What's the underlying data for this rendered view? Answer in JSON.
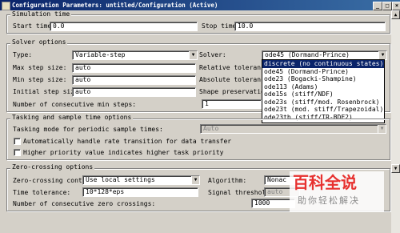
{
  "window": {
    "title": "Configuration Parameters: untitled/Configuration (Active)",
    "minimize": "_",
    "maximize": "□",
    "close": "×"
  },
  "simulation_time": {
    "group_label": "Simulation time",
    "start_label": "Start time:",
    "start_value": "0.0",
    "stop_label": "Stop time:",
    "stop_value": "10.0"
  },
  "solver_options": {
    "group_label": "Solver options",
    "type_label": "Type:",
    "type_value": "Variable-step",
    "solver_label": "Solver:",
    "solver_value": "ode45 (Dormand-Prince)",
    "max_step_label": "Max step size:",
    "max_step_value": "auto",
    "rel_tol_label": "Relative tolerance:",
    "min_step_label": "Min step size:",
    "min_step_value": "auto",
    "abs_tol_label": "Absolute tolerance:",
    "init_step_label": "Initial step size:",
    "init_step_value": "auto",
    "shape_label": "Shape preservation:",
    "consec_min_label": "Number of consecutive min steps:",
    "consec_min_value": "1",
    "solver_options_list": [
      "discrete (no continuous states)",
      "ode45 (Dormand-Prince)",
      "ode23 (Bogacki-Shampine)",
      "ode113 (Adams)",
      "ode15s (stiff/NDF)",
      "ode23s (stiff/mod. Rosenbrock)",
      "ode23t (mod. stiff/Trapezoidal)",
      "ode23tb (stiff/TR-BDF2)"
    ],
    "solver_highlighted_index": 0
  },
  "tasking": {
    "group_label": "Tasking and sample time options",
    "mode_label": "Tasking mode for periodic sample times:",
    "mode_value": "Auto",
    "auto_transition_label": "Automatically handle rate transition for data transfer",
    "higher_priority_label": "Higher priority value indicates higher task priority"
  },
  "zero_crossing": {
    "group_label": "Zero-crossing options",
    "control_label": "Zero-crossing control:",
    "control_value": "Use local settings",
    "algorithm_label": "Algorithm:",
    "algorithm_value": "Nonac",
    "time_tol_label": "Time tolerance:",
    "time_tol_value": "10*128*eps",
    "signal_thresh_label": "Signal threshold:",
    "signal_thresh_value": "auto",
    "consec_zc_label": "Number of consecutive zero crossings:",
    "consec_zc_value": "1000"
  },
  "watermark": {
    "main": "百科全说",
    "sub": "助你轻松解决"
  }
}
